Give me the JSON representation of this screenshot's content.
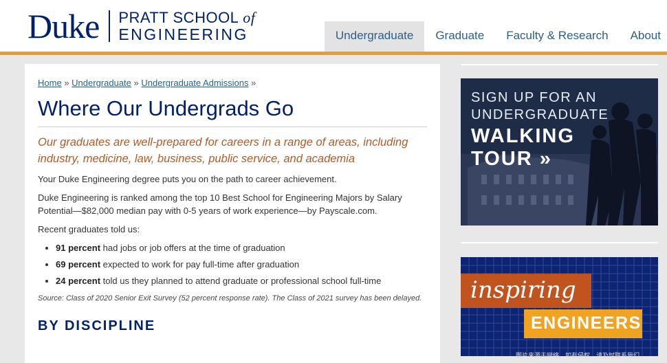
{
  "brand": {
    "duke": "Duke",
    "school_line1": "PRATT SCHOOL",
    "school_of": "of",
    "school_line2": "ENGINEERING"
  },
  "nav": {
    "items": [
      {
        "label": "Undergraduate",
        "active": true
      },
      {
        "label": "Graduate",
        "active": false
      },
      {
        "label": "Faculty & Research",
        "active": false
      },
      {
        "label": "About",
        "active": false
      }
    ]
  },
  "breadcrumb": {
    "items": [
      "Home",
      "Undergraduate",
      "Undergraduate Admissions"
    ],
    "separator": "»"
  },
  "main": {
    "title": "Where Our Undergrads Go",
    "lead": "Our graduates are well-prepared for careers in a range of areas, including industry, medicine, law, business, public service, and academia",
    "para1": "Your Duke Engineering degree puts you on the path to career achievement.",
    "para2": "Duke Engineering is ranked among the top 10 Best School for Engineering Majors by Salary Potential—$82,000 median pay with 0-5 years of work experience—by Payscale.com.",
    "para3": "Recent graduates told us:",
    "stats": [
      {
        "bold": "91 percent",
        "text": " had jobs or job offers at the time of graduation"
      },
      {
        "bold": "69 percent",
        "text": " expected to work for pay full-time after graduation"
      },
      {
        "bold": "24 percent",
        "text": " told us they planned to attend graduate or professional school full-time"
      }
    ],
    "source": "Source: Class of 2020 Senior Exit Survey (52 percent response rate). The Class of 2021 survey has been delayed.",
    "section_heading": "BY DISCIPLINE"
  },
  "sidebar": {
    "walking_tour": {
      "line1": "SIGN UP FOR AN",
      "line2": "UNDERGRADUATE",
      "line3": "WALKING",
      "line4": "TOUR »"
    },
    "inspiring": {
      "word": "inspiring",
      "engineers": "ENGINEERS"
    }
  },
  "watermark": "图片来源于网络，如有侵权，请及时联系我们"
}
